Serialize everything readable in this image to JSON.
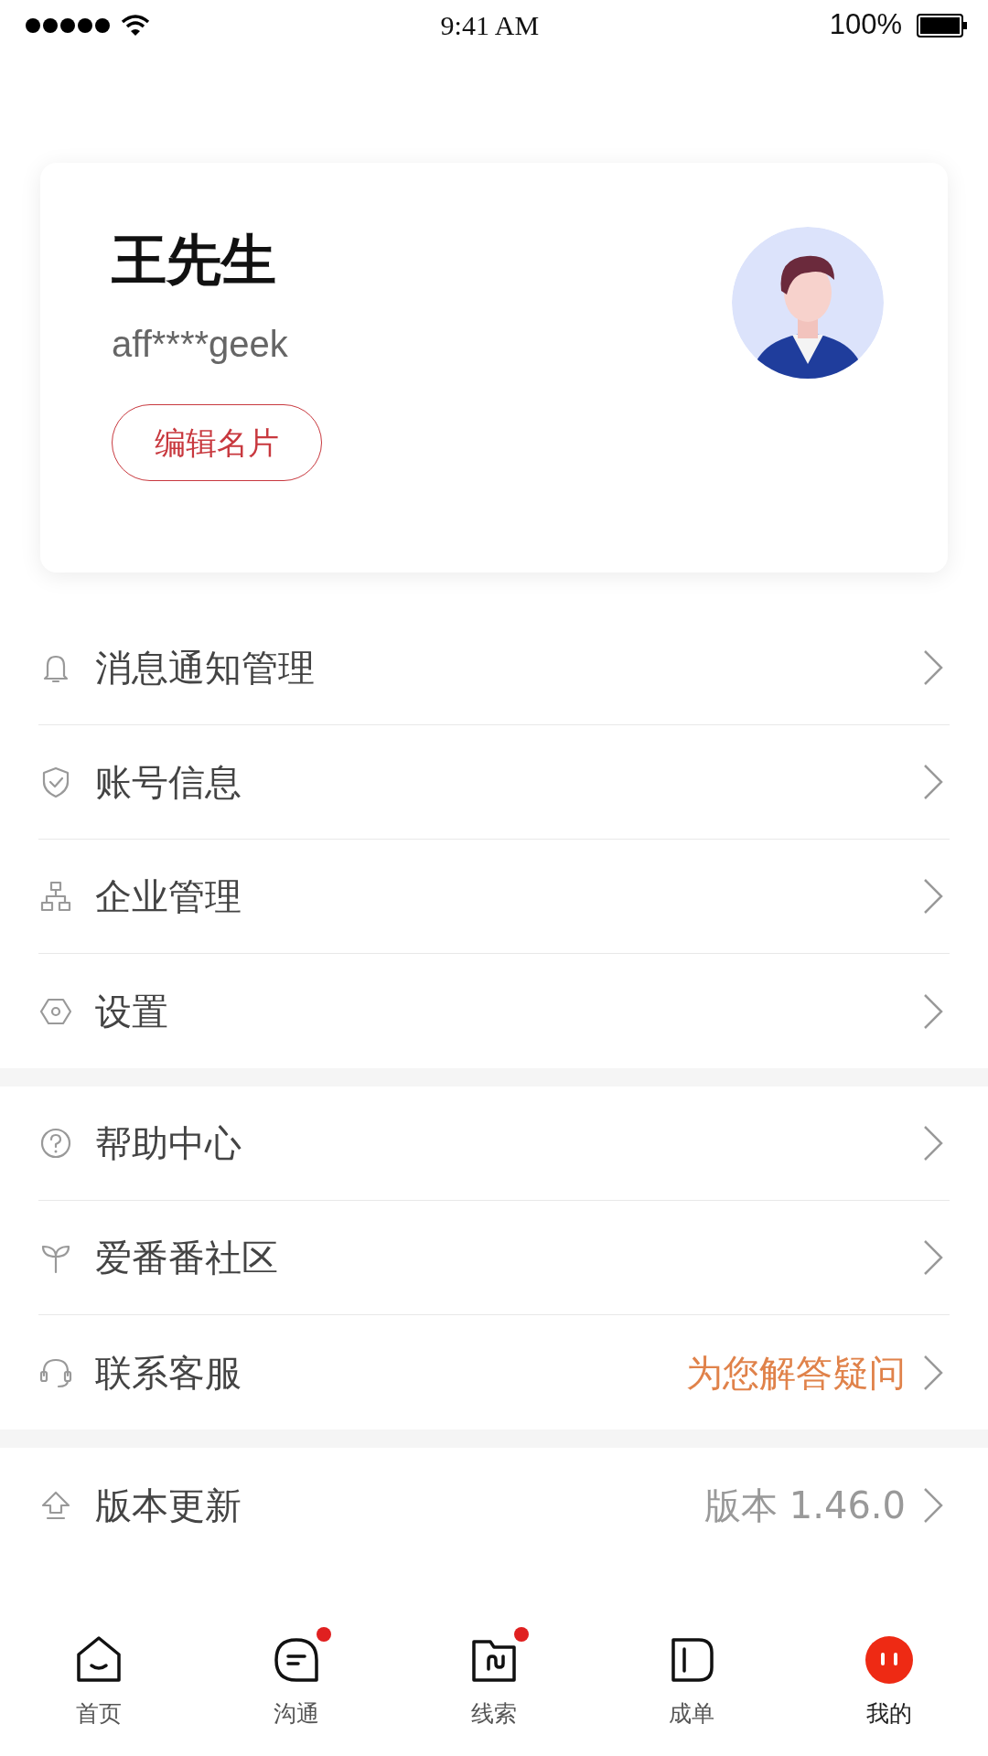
{
  "status_bar": {
    "time": "9:41 AM",
    "battery": "100%"
  },
  "profile": {
    "name": "王先生",
    "account": "aff****geek",
    "edit_button": "编辑名片"
  },
  "menu_groups": [
    {
      "items": [
        {
          "label": "消息通知管理"
        },
        {
          "label": "账号信息"
        },
        {
          "label": "企业管理"
        },
        {
          "label": "设置"
        }
      ]
    },
    {
      "items": [
        {
          "label": "帮助中心"
        },
        {
          "label": "爱番番社区"
        },
        {
          "label": "联系客服",
          "value": {
            "text": "为您解答疑问",
            "color": "#e0824a"
          }
        }
      ]
    },
    {
      "items": [
        {
          "label": "版本更新",
          "value": {
            "text": "版本 1.46.0",
            "color": "#999999"
          }
        }
      ]
    }
  ],
  "tabs": [
    {
      "label": "首页",
      "selected": false,
      "dot": false
    },
    {
      "label": "沟通",
      "selected": false,
      "dot": true
    },
    {
      "label": "线索",
      "selected": false,
      "dot": true
    },
    {
      "label": "成单",
      "selected": false,
      "dot": false
    },
    {
      "label": "我的",
      "selected": true,
      "dot": false
    }
  ]
}
